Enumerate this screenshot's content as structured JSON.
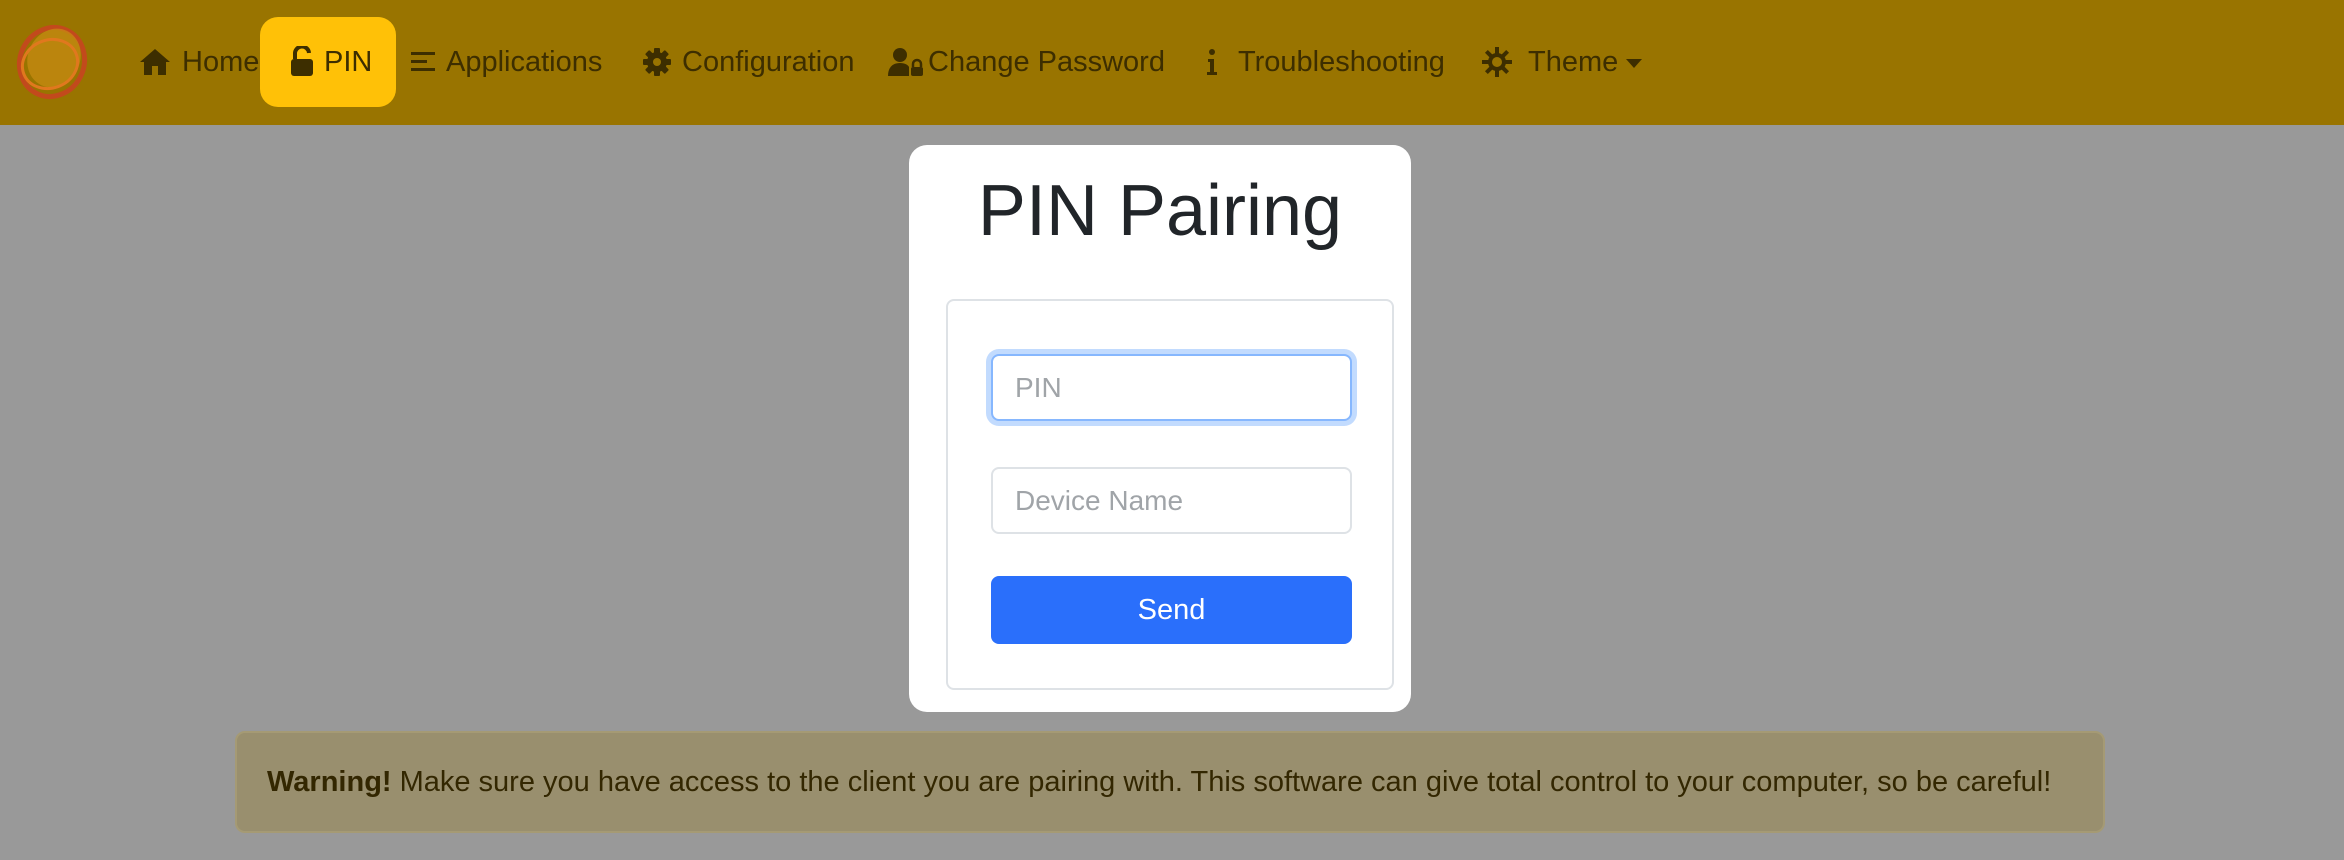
{
  "nav": {
    "items": [
      {
        "label": "Home",
        "icon": "home-icon",
        "active": false
      },
      {
        "label": "PIN",
        "icon": "unlock-icon",
        "active": true
      },
      {
        "label": "Applications",
        "icon": "list-icon",
        "active": false
      },
      {
        "label": "Configuration",
        "icon": "gear-icon",
        "active": false
      },
      {
        "label": "Change Password",
        "icon": "user-lock-icon",
        "active": false
      },
      {
        "label": "Troubleshooting",
        "icon": "info-icon",
        "active": false
      },
      {
        "label": "Theme",
        "icon": "theme-gear-icon",
        "active": false,
        "dropdown": true
      }
    ],
    "logo": "sunshine-logo"
  },
  "card": {
    "title": "PIN Pairing",
    "pin_placeholder": "PIN",
    "pin_value": "",
    "device_placeholder": "Device Name",
    "device_value": "",
    "send_label": "Send"
  },
  "alert": {
    "strong": "Warning!",
    "text": "Make sure you have access to the client you are pairing with. This software can give total control to your computer, so be careful!"
  },
  "colors": {
    "navbar": "#997400",
    "active_tab": "#ffc107",
    "overlay": "#999999",
    "button": "#2a6ffb",
    "alert_bg": "#998f6e"
  }
}
